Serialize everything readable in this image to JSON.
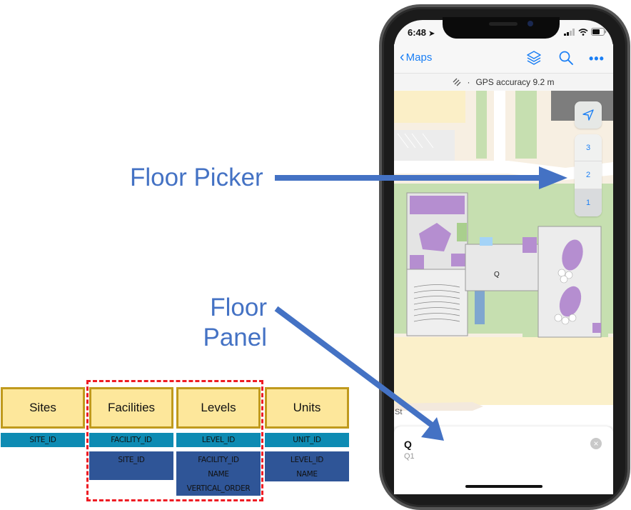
{
  "callouts": {
    "floor_picker": "Floor Picker",
    "floor_panel_line1": "Floor",
    "floor_panel_line2": "Panel"
  },
  "colors": {
    "callout_blue": "#4472c4",
    "table_header_fill": "#fde79b",
    "table_header_border": "#c09a1d",
    "primary_key_fill": "#0e8bb3",
    "foreign_key_fill": "#2f5597",
    "dashed_group_border": "#ee1c24",
    "ios_accent": "#1a7ff5"
  },
  "schema": {
    "tables": [
      {
        "name": "Sites",
        "primary_key": "SITE_ID",
        "fields": []
      },
      {
        "name": "Facilities",
        "primary_key": "FACILITY_ID",
        "fields": [
          "SITE_ID"
        ]
      },
      {
        "name": "Levels",
        "primary_key": "LEVEL_ID",
        "fields": [
          "FACILITY_ID",
          "NAME",
          "VERTICAL_ORDER"
        ]
      },
      {
        "name": "Units",
        "primary_key": "UNIT_ID",
        "fields": [
          "LEVEL_ID",
          "NAME"
        ]
      }
    ],
    "highlighted_group": [
      "Facilities",
      "Levels"
    ]
  },
  "phone": {
    "status_bar": {
      "time": "6:48",
      "location_icon": "location-arrow-icon",
      "signal_icon": "cellular-signal-icon",
      "wifi_icon": "wifi-icon",
      "battery_icon": "battery-icon"
    },
    "nav": {
      "back_label": "Maps",
      "icons": [
        "layers-icon",
        "search-icon",
        "more-icon"
      ]
    },
    "gps_bar": {
      "label": "GPS accuracy 9.2 m",
      "separator": "·"
    },
    "map": {
      "facility_marker_label": "Q",
      "street_label": "St"
    },
    "floor_picker": {
      "levels": [
        "3",
        "2",
        "1"
      ],
      "selected": "1"
    },
    "floor_panel": {
      "title": "Q",
      "subtitle": "Q1",
      "close_symbol": "×"
    }
  }
}
